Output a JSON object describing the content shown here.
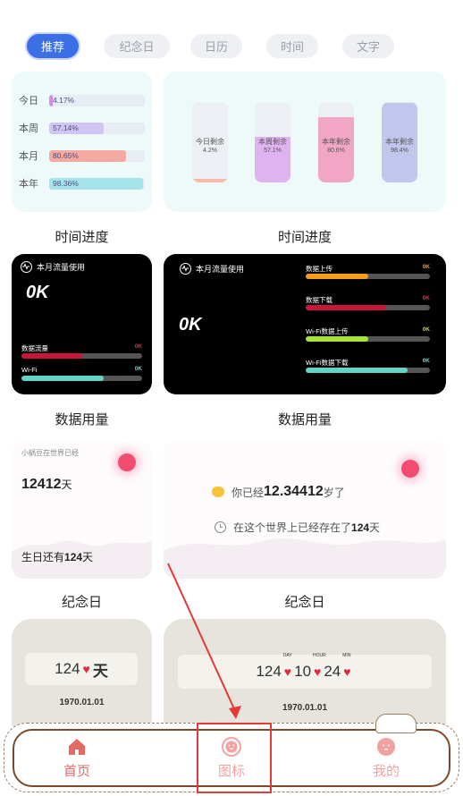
{
  "tabs": [
    {
      "label": "推荐",
      "active": true
    },
    {
      "label": "纪念日",
      "active": false
    },
    {
      "label": "日历",
      "active": false
    },
    {
      "label": "时间",
      "active": false
    },
    {
      "label": "文字",
      "active": false
    }
  ],
  "time_progress": {
    "caption": "时间进度",
    "rows": [
      {
        "label": "今日",
        "value": "4.17%",
        "fraction": 0.0417,
        "color": "#d88ce6"
      },
      {
        "label": "本周",
        "value": "57.14%",
        "fraction": 0.5714,
        "color": "#d2c4f3"
      },
      {
        "label": "本月",
        "value": "80.65%",
        "fraction": 0.8065,
        "color": "#f5a9a0"
      },
      {
        "label": "本年",
        "value": "98.36%",
        "fraction": 0.9836,
        "color": "#a6e3ea"
      }
    ],
    "bars": [
      {
        "label": "今日剩余",
        "value": "4.2%",
        "fraction": 0.042,
        "color": "#f7b9a9"
      },
      {
        "label": "本周剩余",
        "value": "57.1%",
        "fraction": 0.571,
        "color": "#dfb2f0"
      },
      {
        "label": "本年剩余",
        "value": "80.6%",
        "fraction": 0.806,
        "color": "#f2a6c5"
      },
      {
        "label": "本年剩余",
        "value": "98.4%",
        "fraction": 0.984,
        "color": "#c2c6ec"
      }
    ]
  },
  "data_usage": {
    "caption": "数据用量",
    "header": "本月流量使用",
    "total": "0K",
    "small_rows": [
      {
        "name": "数据流量",
        "value": "0K",
        "fraction": 0.5,
        "color": "#c8163a",
        "valcolor": "#e0304c"
      },
      {
        "name": "Wi-Fi",
        "value": "0K",
        "fraction": 0.68,
        "color": "#5fd6c5",
        "valcolor": "#5fd6c5"
      }
    ],
    "large_rows": [
      {
        "name": "数据上传",
        "value": "0K",
        "fraction": 0.5,
        "color": "#f79c1c",
        "valcolor": "#f79c1c"
      },
      {
        "name": "数据下载",
        "value": "0K",
        "fraction": 0.65,
        "color": "#c8163a",
        "valcolor": "#e0304c"
      },
      {
        "name": "Wi-Fi数据上传",
        "value": "0K",
        "fraction": 0.5,
        "color": "#a7e33c",
        "valcolor": "#a7e33c"
      },
      {
        "name": "Wi-Fi数据下载",
        "value": "0K",
        "fraction": 0.82,
        "color": "#5fd6c5",
        "valcolor": "#5fd6c5"
      }
    ]
  },
  "anniversary": {
    "caption": "纪念日",
    "small_title": "小蜗豆在世界已经",
    "small_days": "12412",
    "small_days_unit": "天",
    "birthday_prefix": "生日还有",
    "birthday_days": "124",
    "birthday_unit": "天",
    "age_prefix": "你已经",
    "age_value": "12.34412",
    "age_unit": "岁了",
    "exist_prefix": "在这个世界上已经存在了",
    "exist_days": "124",
    "exist_unit": "天"
  },
  "countdown": {
    "small_days": "124",
    "small_unit": "天",
    "small_date": "1970.01.01",
    "large_days": "124",
    "large_hours": "10",
    "large_mins": "24",
    "day_label": "DAY",
    "hour_label": "HOUR",
    "min_label": "MIN",
    "large_date": "1970.01.01"
  },
  "nav": {
    "items": [
      {
        "label": "首页",
        "icon": "home-icon",
        "color": "#e46a66"
      },
      {
        "label": "图标",
        "icon": "smile-icon",
        "color": "#f3a0a0"
      },
      {
        "label": "我的",
        "icon": "profile-icon",
        "color": "#f3a0a0"
      }
    ]
  }
}
